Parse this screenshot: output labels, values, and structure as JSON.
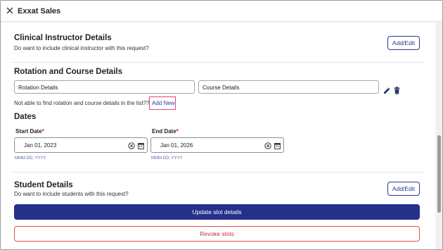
{
  "window": {
    "title": "Exxat Sales"
  },
  "clinical_instructor": {
    "title": "Clinical Instructor Details",
    "subtitle": "Do want to include clinical instructor with this request?",
    "button_label": "Add/Edit"
  },
  "rotation": {
    "title": "Rotation and Course Details",
    "rotation_placeholder": "Rotation Details",
    "course_placeholder": "Course Details",
    "not_found_text": "Not able to find rotation and course details in the list??",
    "add_new_label": "Add New"
  },
  "dates": {
    "title": "Dates",
    "start_label": "Start Date",
    "start_value": "Jan 01, 2023",
    "end_label": "End Date",
    "end_value": "Jan 01, 2026",
    "required_mark": "*",
    "format_hint": "MMM DD, YYYY"
  },
  "students": {
    "title": "Student Details",
    "subtitle": "Do want to include students with this request?",
    "button_label": "Add/Edit"
  },
  "actions": {
    "update_label": "Update slot details",
    "revoke_label": "Revoke slots"
  },
  "icons": [
    "close-icon",
    "pencil-icon",
    "trash-icon",
    "clear-icon",
    "calendar-icon"
  ],
  "colors": {
    "primary": "#24308a",
    "link": "#2a3ab5",
    "danger": "#c83030",
    "required": "#d02030",
    "highlight": "#e0447a"
  }
}
